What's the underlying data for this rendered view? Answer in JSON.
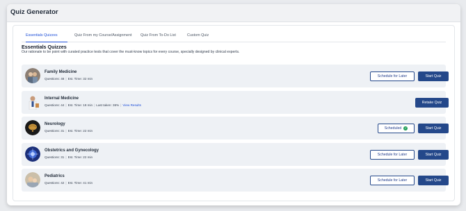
{
  "header": {
    "title": "Quiz Generator"
  },
  "tabs": [
    {
      "label": "Essentials Quizzes",
      "active": true
    },
    {
      "label": "Quiz From my Course/Assignment",
      "active": false
    },
    {
      "label": "Quiz From To-Do List",
      "active": false
    },
    {
      "label": "Custom Quiz",
      "active": false
    }
  ],
  "section": {
    "title": "Essentials Quizzes",
    "description": "Our rationale to be point with curated practice tests that cover the must-know topics for every course, specially designed by clinical experts."
  },
  "quizzes": [
    {
      "title": "Family Medicine",
      "questions": "Questions: 48",
      "time": "Est. Time: 32 min",
      "secondary_label": "Schedule for Later",
      "primary_label": "Start Quiz"
    },
    {
      "title": "Internal Medicine",
      "questions": "Questions: 44",
      "time": "Est. Time: 18 min",
      "last_taken": "Last taken: 36%",
      "view_results": "View Results",
      "primary_label": "Retake Quiz"
    },
    {
      "title": "Neurology",
      "questions": "Questions: 31",
      "time": "Est. Time: 22 min",
      "status_label": "Scheduled",
      "primary_label": "Start Quiz"
    },
    {
      "title": "Obstetrics and Gynecology",
      "questions": "Questions: 31",
      "time": "Est. Time: 22 min",
      "secondary_label": "Schedule for Later",
      "primary_label": "Start Quiz"
    },
    {
      "title": "Pediatrics",
      "questions": "Questions: 42",
      "time": "Est. Time: 41 min",
      "secondary_label": "Schedule for Later",
      "primary_label": "Start Quiz"
    }
  ],
  "icons": {
    "scheduled_check": "check-circle-icon"
  },
  "colors": {
    "accent": "#24488a",
    "link": "#1d4ed8",
    "success": "#22a05a",
    "row_bg": "#eef1f5"
  }
}
